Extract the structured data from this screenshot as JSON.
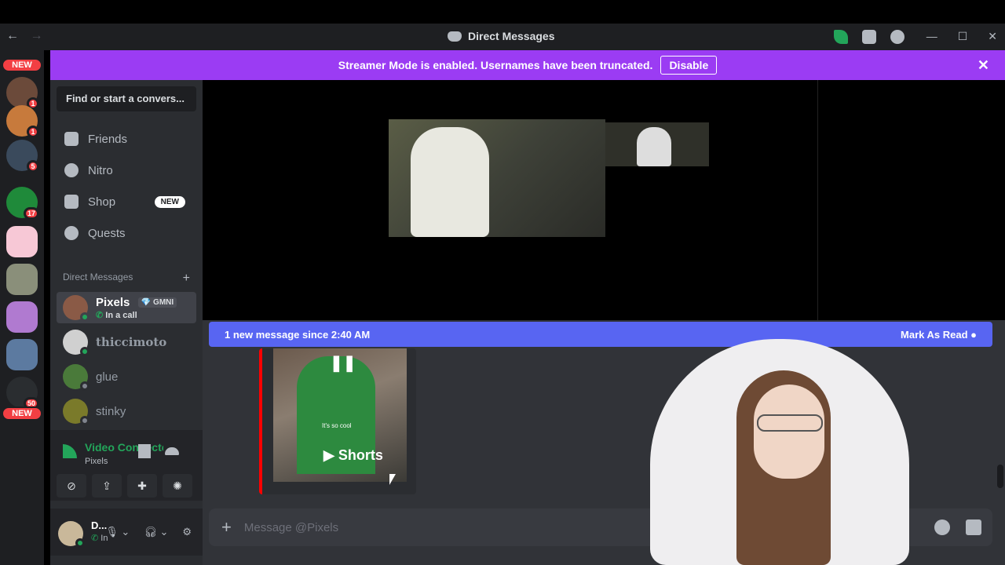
{
  "window": {
    "title": "Direct Messages",
    "back_icon": "←",
    "forward_icon": "→",
    "minimize": "—",
    "maximize": "☐",
    "close": "✕"
  },
  "banner": {
    "text": "Streamer Mode is enabled. Usernames have been truncated.",
    "button": "Disable",
    "close": "✕",
    "color": "#9b3cf3"
  },
  "servers": [
    {
      "badge": "NEW"
    },
    {
      "badge": "1"
    },
    {
      "badge": "1"
    },
    {
      "badge": "5"
    },
    {
      "badge": "17"
    },
    {
      "badge": ""
    },
    {
      "badge": ""
    },
    {
      "badge": ""
    },
    {
      "badge": ""
    },
    {
      "badge": "50"
    },
    {
      "badge": "NEW"
    }
  ],
  "sidebar": {
    "search": "Find or start a convers...",
    "nav": [
      {
        "label": "Friends"
      },
      {
        "label": "Nitro"
      },
      {
        "label": "Shop",
        "pill": "NEW"
      },
      {
        "label": "Quests"
      }
    ],
    "dm_header": "Direct Messages",
    "dm_add": "+",
    "dms": [
      {
        "name": "Pixels",
        "tag": "💎 GMNI",
        "sub": "In a call"
      },
      {
        "name": "thiccimoto"
      },
      {
        "name": "glue"
      },
      {
        "name": "stinky"
      }
    ]
  },
  "voice": {
    "title": "Video Connecte",
    "sub": "Pixels"
  },
  "user": {
    "name": "D...",
    "status": "In"
  },
  "chat": {
    "new_message": "1 new message since 2:40 AM",
    "mark_read": "Mark As Read",
    "embed_caption": "It's so cool",
    "shorts": "Shorts",
    "composer_placeholder": "Message @Pixels"
  },
  "colors": {
    "accent": "#5865f2",
    "online": "#23a55a",
    "danger": "#f23f43"
  }
}
